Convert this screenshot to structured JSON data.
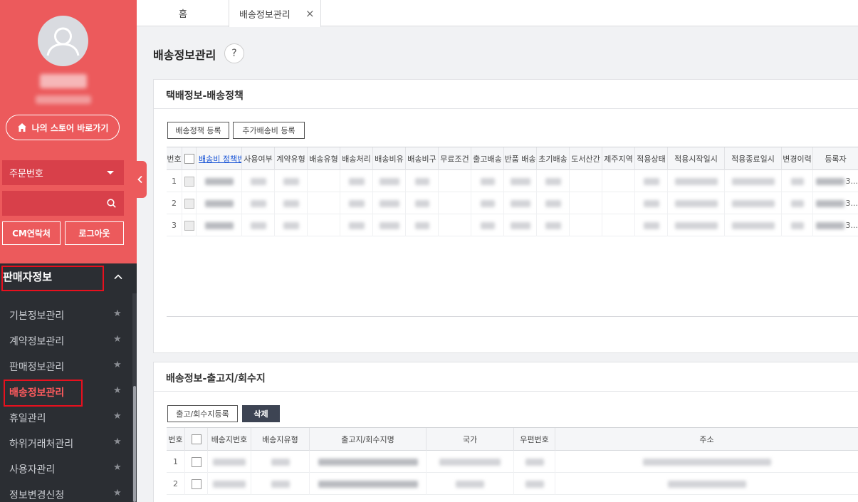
{
  "sidebar": {
    "store_button": "나의 스토어 바로가기",
    "select_placeholder": "주문번호",
    "cm_button": "CM연락처",
    "logout_button": "로그아웃",
    "section_title": "판매자정보",
    "items": [
      {
        "label": "기본정보관리"
      },
      {
        "label": "계약정보관리"
      },
      {
        "label": "판매정보관리"
      },
      {
        "label": "배송정보관리"
      },
      {
        "label": "휴일관리"
      },
      {
        "label": "하위거래처관리"
      },
      {
        "label": "사용자관리"
      },
      {
        "label": "정보변경신청"
      }
    ],
    "active_index": 3
  },
  "tabs": {
    "home": "홈",
    "current": "배송정보관리",
    "close": "×"
  },
  "page": {
    "title": "배송정보관리",
    "help": "?"
  },
  "panel1": {
    "title": "택배정보-배송정책",
    "buttons": [
      "배송정책 등록",
      "추가배송비 등록"
    ],
    "columns": [
      "번호",
      "",
      "배송비 정책번",
      "사용여부",
      "계약유형",
      "배송유형",
      "배송처리",
      "배송비유",
      "배송비구",
      "무료조건",
      "출고배송",
      "반품 배송",
      "초기배송",
      "도서산간",
      "제주지역",
      "적용상태",
      "적용시작일시",
      "적용종료일시",
      "변경이력",
      "등록자"
    ],
    "rows": [
      {
        "no": "1",
        "tail": "3..."
      },
      {
        "no": "2",
        "tail": "3..."
      },
      {
        "no": "3",
        "tail": "3..."
      }
    ]
  },
  "panel2": {
    "title": "배송정보-출고지/회수지",
    "buttons": [
      "출고/회수지등록",
      "삭제"
    ],
    "columns": [
      "번호",
      "",
      "배송지번호",
      "배송지유형",
      "출고지/회수지명",
      "국가",
      "우편번호",
      "주소"
    ],
    "rows": [
      {
        "no": "1"
      },
      {
        "no": "2"
      }
    ]
  },
  "colors": {
    "accent": "#ec5a5c",
    "sidebar_dark": "#2b2e33",
    "highlight_box": "#e8101e"
  }
}
